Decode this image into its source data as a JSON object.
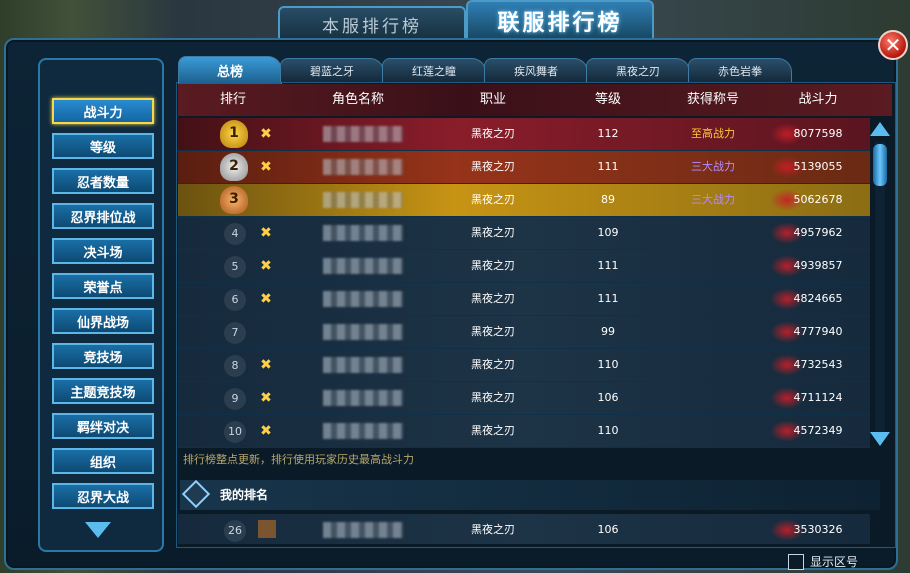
{
  "top_tabs": {
    "local": "本服排行榜",
    "union": "联服排行榜"
  },
  "close_label": "✕",
  "side_menu": [
    "战斗力",
    "等级",
    "忍者数量",
    "忍界排位战",
    "决斗场",
    "荣誉点",
    "仙界战场",
    "竞技场",
    "主题竞技场",
    "羁绊对决",
    "组织",
    "忍界大战"
  ],
  "active_side": "战斗力",
  "sub_tabs": [
    "总榜",
    "碧蓝之牙",
    "红莲之瞳",
    "疾风舞者",
    "黑夜之刃",
    "赤色岩拳"
  ],
  "active_sub": "总榜",
  "columns": {
    "rank": "排行",
    "name": "角色名称",
    "class": "职业",
    "level": "等级",
    "title": "获得称号",
    "power": "战斗力"
  },
  "rows": [
    {
      "rank": "1",
      "trophy": "gold",
      "class": "黑夜之刃",
      "level": "112",
      "title": "至高战力",
      "title_style": "gold",
      "power": "8077598"
    },
    {
      "rank": "2",
      "trophy": "silver",
      "class": "黑夜之刃",
      "level": "111",
      "title": "三大战力",
      "title_style": "purple",
      "power": "5139055"
    },
    {
      "rank": "3",
      "trophy": "bronze",
      "class": "黑夜之刃",
      "level": "89",
      "title": "三大战力",
      "title_style": "purple",
      "power": "5062678"
    },
    {
      "rank": "4",
      "class": "黑夜之刃",
      "level": "109",
      "title": "",
      "power": "4957962"
    },
    {
      "rank": "5",
      "class": "黑夜之刃",
      "level": "111",
      "title": "",
      "power": "4939857"
    },
    {
      "rank": "6",
      "class": "黑夜之刃",
      "level": "111",
      "title": "",
      "power": "4824665"
    },
    {
      "rank": "7",
      "class": "黑夜之刃",
      "level": "99",
      "title": "",
      "power": "4777940"
    },
    {
      "rank": "8",
      "class": "黑夜之刃",
      "level": "110",
      "title": "",
      "power": "4732543"
    },
    {
      "rank": "9",
      "class": "黑夜之刃",
      "level": "106",
      "title": "",
      "power": "4711124"
    },
    {
      "rank": "10",
      "class": "黑夜之刃",
      "level": "110",
      "title": "",
      "power": "4572349"
    }
  ],
  "note": "排行榜整点更新，排行使用玩家历史最高战斗力",
  "my_rank": {
    "label": "我的排名",
    "rank": "26",
    "class": "黑夜之刃",
    "level": "106",
    "power": "3530326"
  },
  "show_zone": "显示区号"
}
